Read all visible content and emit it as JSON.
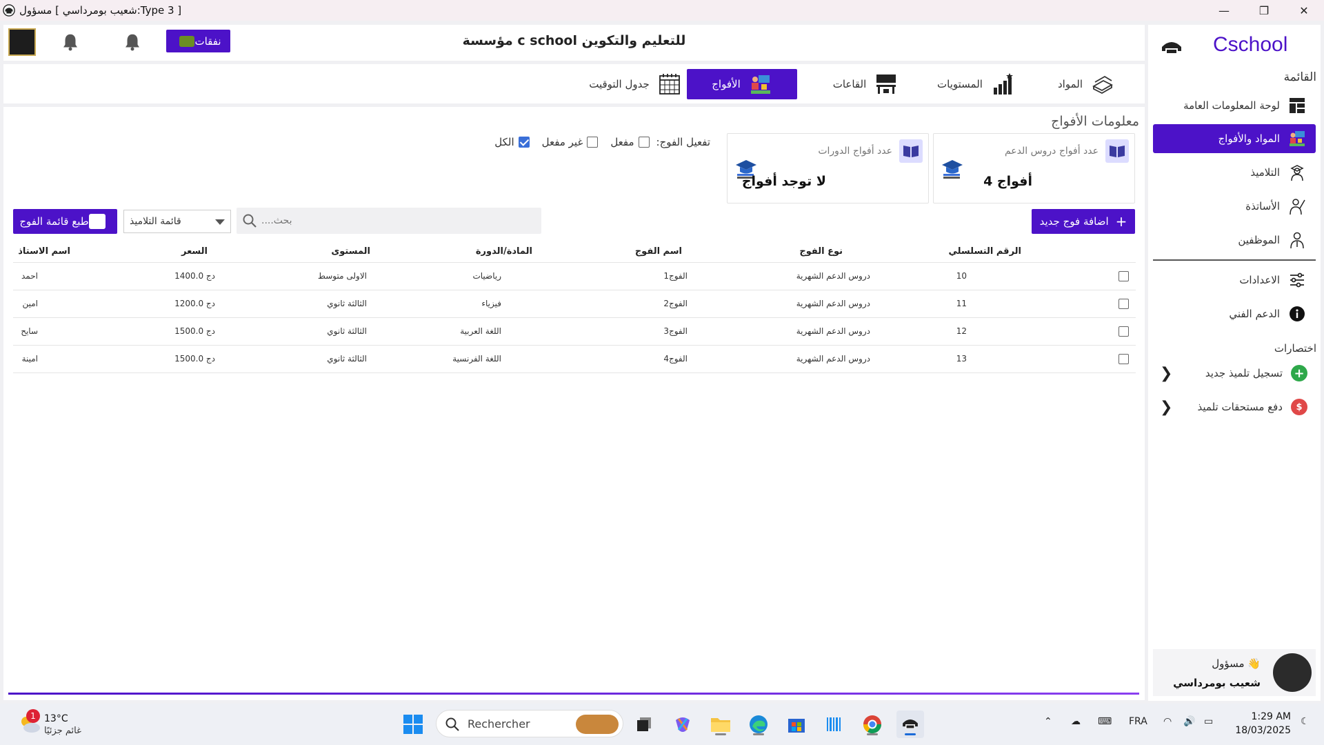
{
  "window": {
    "title": "مسؤول [ شعيب بومرداسي:Type 3 ]",
    "minimize_glyph": "—",
    "restore_glyph": "❐",
    "close_glyph": "✕"
  },
  "header": {
    "title": "مؤسسة c school للتعليم والتكوين",
    "expenses_label": "نفقات"
  },
  "sidebar": {
    "brand": "Cschool",
    "menu_title": "القائمة",
    "items": [
      {
        "label": "لوحة المعلومات العامة",
        "icon": "dashboard-icon"
      },
      {
        "label": "المواد والأفواج",
        "icon": "subjects-groups-icon",
        "active": true
      },
      {
        "label": "التلاميذ",
        "icon": "student-icon"
      },
      {
        "label": "الأساتذة",
        "icon": "teacher-icon"
      },
      {
        "label": "الموظفين",
        "icon": "employee-icon"
      }
    ],
    "settings_label": "الاعدادات",
    "support_label": "الدعم الفني",
    "shortcuts_title": "اختصارات",
    "shortcuts": [
      {
        "label": "تسجيل تلميذ جديد",
        "icon": "add-circle-icon",
        "color": "#2ea84a",
        "glyph": "+"
      },
      {
        "label": "دفع مستحقات تلميذ",
        "icon": "payment-icon",
        "color": "#e04848",
        "glyph": "$"
      }
    ],
    "user": {
      "role": "مسؤول 👋",
      "name": "شعيب بومرداسي"
    }
  },
  "tabs": [
    {
      "label": "المواد",
      "icon": "books-icon"
    },
    {
      "label": "المستويات",
      "icon": "levels-chart-icon"
    },
    {
      "label": "القاعات",
      "icon": "classroom-icon"
    },
    {
      "label": "الأفواج",
      "icon": "groups-icon",
      "active": true
    },
    {
      "label": "جدول التوقيت",
      "icon": "calendar-icon"
    }
  ],
  "section": {
    "title": "معلومات الأفواج"
  },
  "stats": [
    {
      "caption": "عدد أفواج دروس الدعم",
      "value": "4 أفواج"
    },
    {
      "caption": "عدد أفواج الدورات",
      "value": "لا توجد أفواج"
    }
  ],
  "filters": {
    "label": "تفعيل الفوج:",
    "options": [
      {
        "label": "مفعل",
        "checked": false
      },
      {
        "label": "غير مفعل",
        "checked": false
      },
      {
        "label": "الكل",
        "checked": true
      }
    ]
  },
  "actions": {
    "add_group": "اضافة فوج جديد",
    "print_list": "طبع قائمة الفوج",
    "list_select": "قائمة التلاميذ",
    "search_placeholder": "بحث...."
  },
  "table": {
    "headers": {
      "serial": "الرقم التسلسلي",
      "type": "نوع الفوج",
      "name": "اسم الفوج",
      "subject": "المادة/الدورة",
      "level": "المستوى",
      "price": "السعر",
      "teacher": "اسم الاستاذ"
    },
    "rows": [
      {
        "serial": "10",
        "type": "دروس الدعم الشهرية",
        "name": "الفوج1",
        "subject": "رياضيات",
        "level": "الاولى متوسط",
        "price": "1400.0 دج",
        "teacher": "احمد"
      },
      {
        "serial": "11",
        "type": "دروس الدعم الشهرية",
        "name": "الفوج2",
        "subject": "فيزياء",
        "level": "الثالثة ثانوي",
        "price": "1200.0 دج",
        "teacher": "امين"
      },
      {
        "serial": "12",
        "type": "دروس الدعم الشهرية",
        "name": "الفوج3",
        "subject": "اللغة العربية",
        "level": "الثالثة ثانوي",
        "price": "1500.0 دج",
        "teacher": "سايح"
      },
      {
        "serial": "13",
        "type": "دروس الدعم الشهرية",
        "name": "الفوج4",
        "subject": "اللغة الفرنسية",
        "level": "الثالثة ثانوي",
        "price": "1500.0 دج",
        "teacher": "امينة"
      }
    ]
  },
  "taskbar": {
    "weather_badge": "1",
    "temperature": "13°C",
    "condition": "غائم جزئيًا",
    "search_placeholder": "Rechercher",
    "language": "FRA",
    "time": "1:29 AM",
    "date": "18/03/2025"
  },
  "colors": {
    "accent": "#4c12c8",
    "sidebar_bg": "#ffffff",
    "checkbox_blue": "#3a6fd8"
  }
}
